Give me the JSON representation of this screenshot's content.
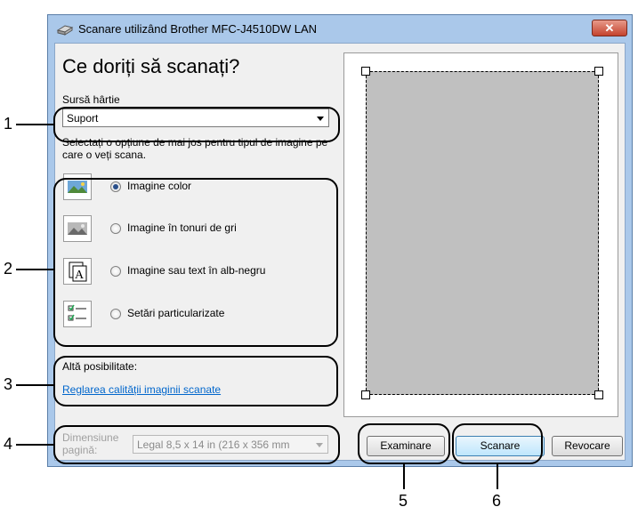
{
  "window": {
    "title": "Scanare utilizând Brother MFC-J4510DW LAN",
    "close_glyph": "✕"
  },
  "dialog": {
    "heading": "Ce doriți să scanați?",
    "paper_source_label": "Sursă hârtie",
    "paper_source_value": "Suport",
    "instructions": "Selectați o opțiune de mai jos pentru tipul de imagine pe care o veți scana.",
    "options": [
      {
        "label": "Imagine color",
        "selected": true,
        "icon": "color-image-icon"
      },
      {
        "label": "Imagine în tonuri de gri",
        "selected": false,
        "icon": "grayscale-image-icon"
      },
      {
        "label": "Imagine sau text în alb-negru",
        "selected": false,
        "icon": "black-white-text-icon"
      },
      {
        "label": "Setări particularizate",
        "selected": false,
        "icon": "custom-settings-icon"
      }
    ],
    "other_label": "Altă posibilitate:",
    "other_link": "Reglarea calității imaginii scanate",
    "page_size_label_1": "Dimensiune",
    "page_size_label_2": "pagină:",
    "page_size_value": "Legal 8,5 x 14 in (216 x 356 mm",
    "buttons": {
      "preview": "Examinare",
      "scan": "Scanare",
      "cancel": "Revocare"
    }
  },
  "callouts": [
    "1",
    "2",
    "3",
    "4",
    "5",
    "6"
  ],
  "colors": {
    "frame": "#aac8ea",
    "link": "#0066cc",
    "preview_area": "#c0c0c0"
  }
}
